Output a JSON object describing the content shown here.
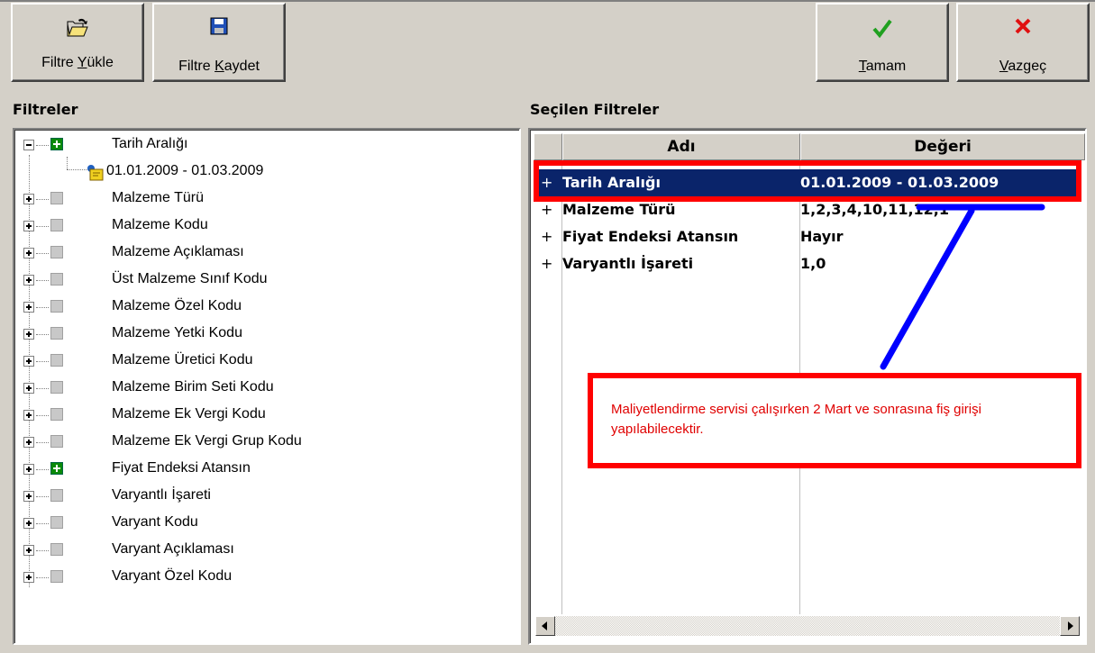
{
  "toolbar": {
    "load": {
      "pre": "Filtre ",
      "key": "Y",
      "post": "ükle",
      "icon": "open-folder-icon"
    },
    "save": {
      "pre": "Filtre ",
      "key": "K",
      "post": "aydet",
      "icon": "floppy-disk-icon"
    },
    "ok": {
      "pre": "",
      "key": "T",
      "post": "amam",
      "icon": "green-check-icon"
    },
    "cancel": {
      "pre": "",
      "key": "V",
      "post": "azgeç",
      "icon": "red-x-icon"
    }
  },
  "filters_title": "Filtreler",
  "selected_title": "Seçilen Filtreler",
  "tree": {
    "root_label": "Tarih Aralığı",
    "child_label": "01.01.2009 - 01.03.2009",
    "items": [
      "Malzeme Türü",
      "Malzeme Kodu",
      "Malzeme Açıklaması",
      "Üst Malzeme Sınıf Kodu",
      "Malzeme Özel Kodu",
      "Malzeme Yetki Kodu",
      "Malzeme Üretici Kodu",
      "Malzeme Birim Seti Kodu",
      "Malzeme Ek Vergi Kodu",
      "Malzeme Ek Vergi Grup Kodu",
      "Fiyat Endeksi Atansın",
      "Varyantlı İşareti",
      "Varyant Kodu",
      "Varyant Açıklaması",
      "Varyant Özel Kodu"
    ]
  },
  "grid": {
    "col_name": "Adı",
    "col_value": "Değeri",
    "rows": [
      {
        "plus": "+",
        "name": "Tarih Aralığı",
        "value": "01.01.2009 - 01.03.2009"
      },
      {
        "plus": "+",
        "name": "Malzeme Türü",
        "value": "1,2,3,4,10,11,12,1"
      },
      {
        "plus": "+",
        "name": "Fiyat Endeksi Atansın",
        "value": "Hayır"
      },
      {
        "plus": "+",
        "name": "Varyantlı İşareti",
        "value": "1,0"
      }
    ]
  },
  "note": "Maliyetlendirme servisi çalışırken 2 Mart ve sonrasına fiş girişi yapılabilecektir.",
  "colors": {
    "highlight": "#ff0000",
    "selection": "#0a246a",
    "arrow": "#0000ff",
    "check_green": "#0a8a0a"
  }
}
